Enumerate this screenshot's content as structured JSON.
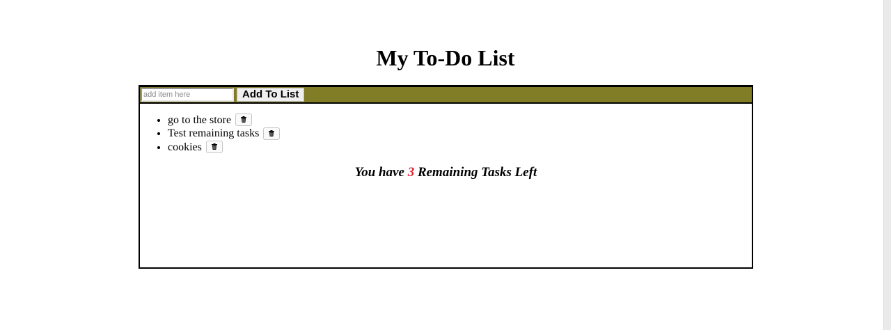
{
  "page": {
    "title": "My To-Do List"
  },
  "toolbar": {
    "input_placeholder": "add item here",
    "input_value": "",
    "add_button_label": "Add To List",
    "background_color": "#817c26"
  },
  "items": [
    {
      "label": "go to the store",
      "delete_icon": "trash-icon"
    },
    {
      "label": "Test remaining tasks",
      "delete_icon": "trash-icon"
    },
    {
      "label": "cookies",
      "delete_icon": "trash-icon"
    }
  ],
  "summary": {
    "prefix": "You have",
    "count": "3",
    "suffix": "Remaining Tasks Left",
    "count_color": "#e01e2e"
  }
}
